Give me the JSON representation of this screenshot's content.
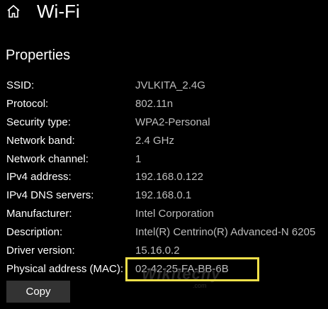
{
  "header": {
    "home_icon": "home-icon",
    "title": "Wi-Fi"
  },
  "section": {
    "title": "Properties"
  },
  "properties": [
    {
      "label": "SSID:",
      "value": "JVLKITA_2.4G"
    },
    {
      "label": "Protocol:",
      "value": "802.11n"
    },
    {
      "label": "Security type:",
      "value": "WPA2-Personal"
    },
    {
      "label": "Network band:",
      "value": "2.4 GHz"
    },
    {
      "label": "Network channel:",
      "value": "1"
    },
    {
      "label": "IPv4 address:",
      "value": "192.168.0.122"
    },
    {
      "label": "IPv4 DNS servers:",
      "value": "192.168.0.1"
    },
    {
      "label": "Manufacturer:",
      "value": "Intel Corporation"
    },
    {
      "label": "Description:",
      "value": "Intel(R) Centrino(R) Advanced-N 6205"
    },
    {
      "label": "Driver version:",
      "value": "15.16.0.2"
    },
    {
      "label": "Physical address (MAC):",
      "value": "02-42-25-FA-BB-6B"
    }
  ],
  "copy_button": {
    "label": "Copy"
  },
  "watermark": {
    "text": "Wikitechy",
    "sub": ".com"
  },
  "colors": {
    "background": "#000000",
    "label_text": "#ffffff",
    "value_text": "#bdbdbd",
    "highlight": "#f2e04a",
    "button_bg": "#333333"
  }
}
